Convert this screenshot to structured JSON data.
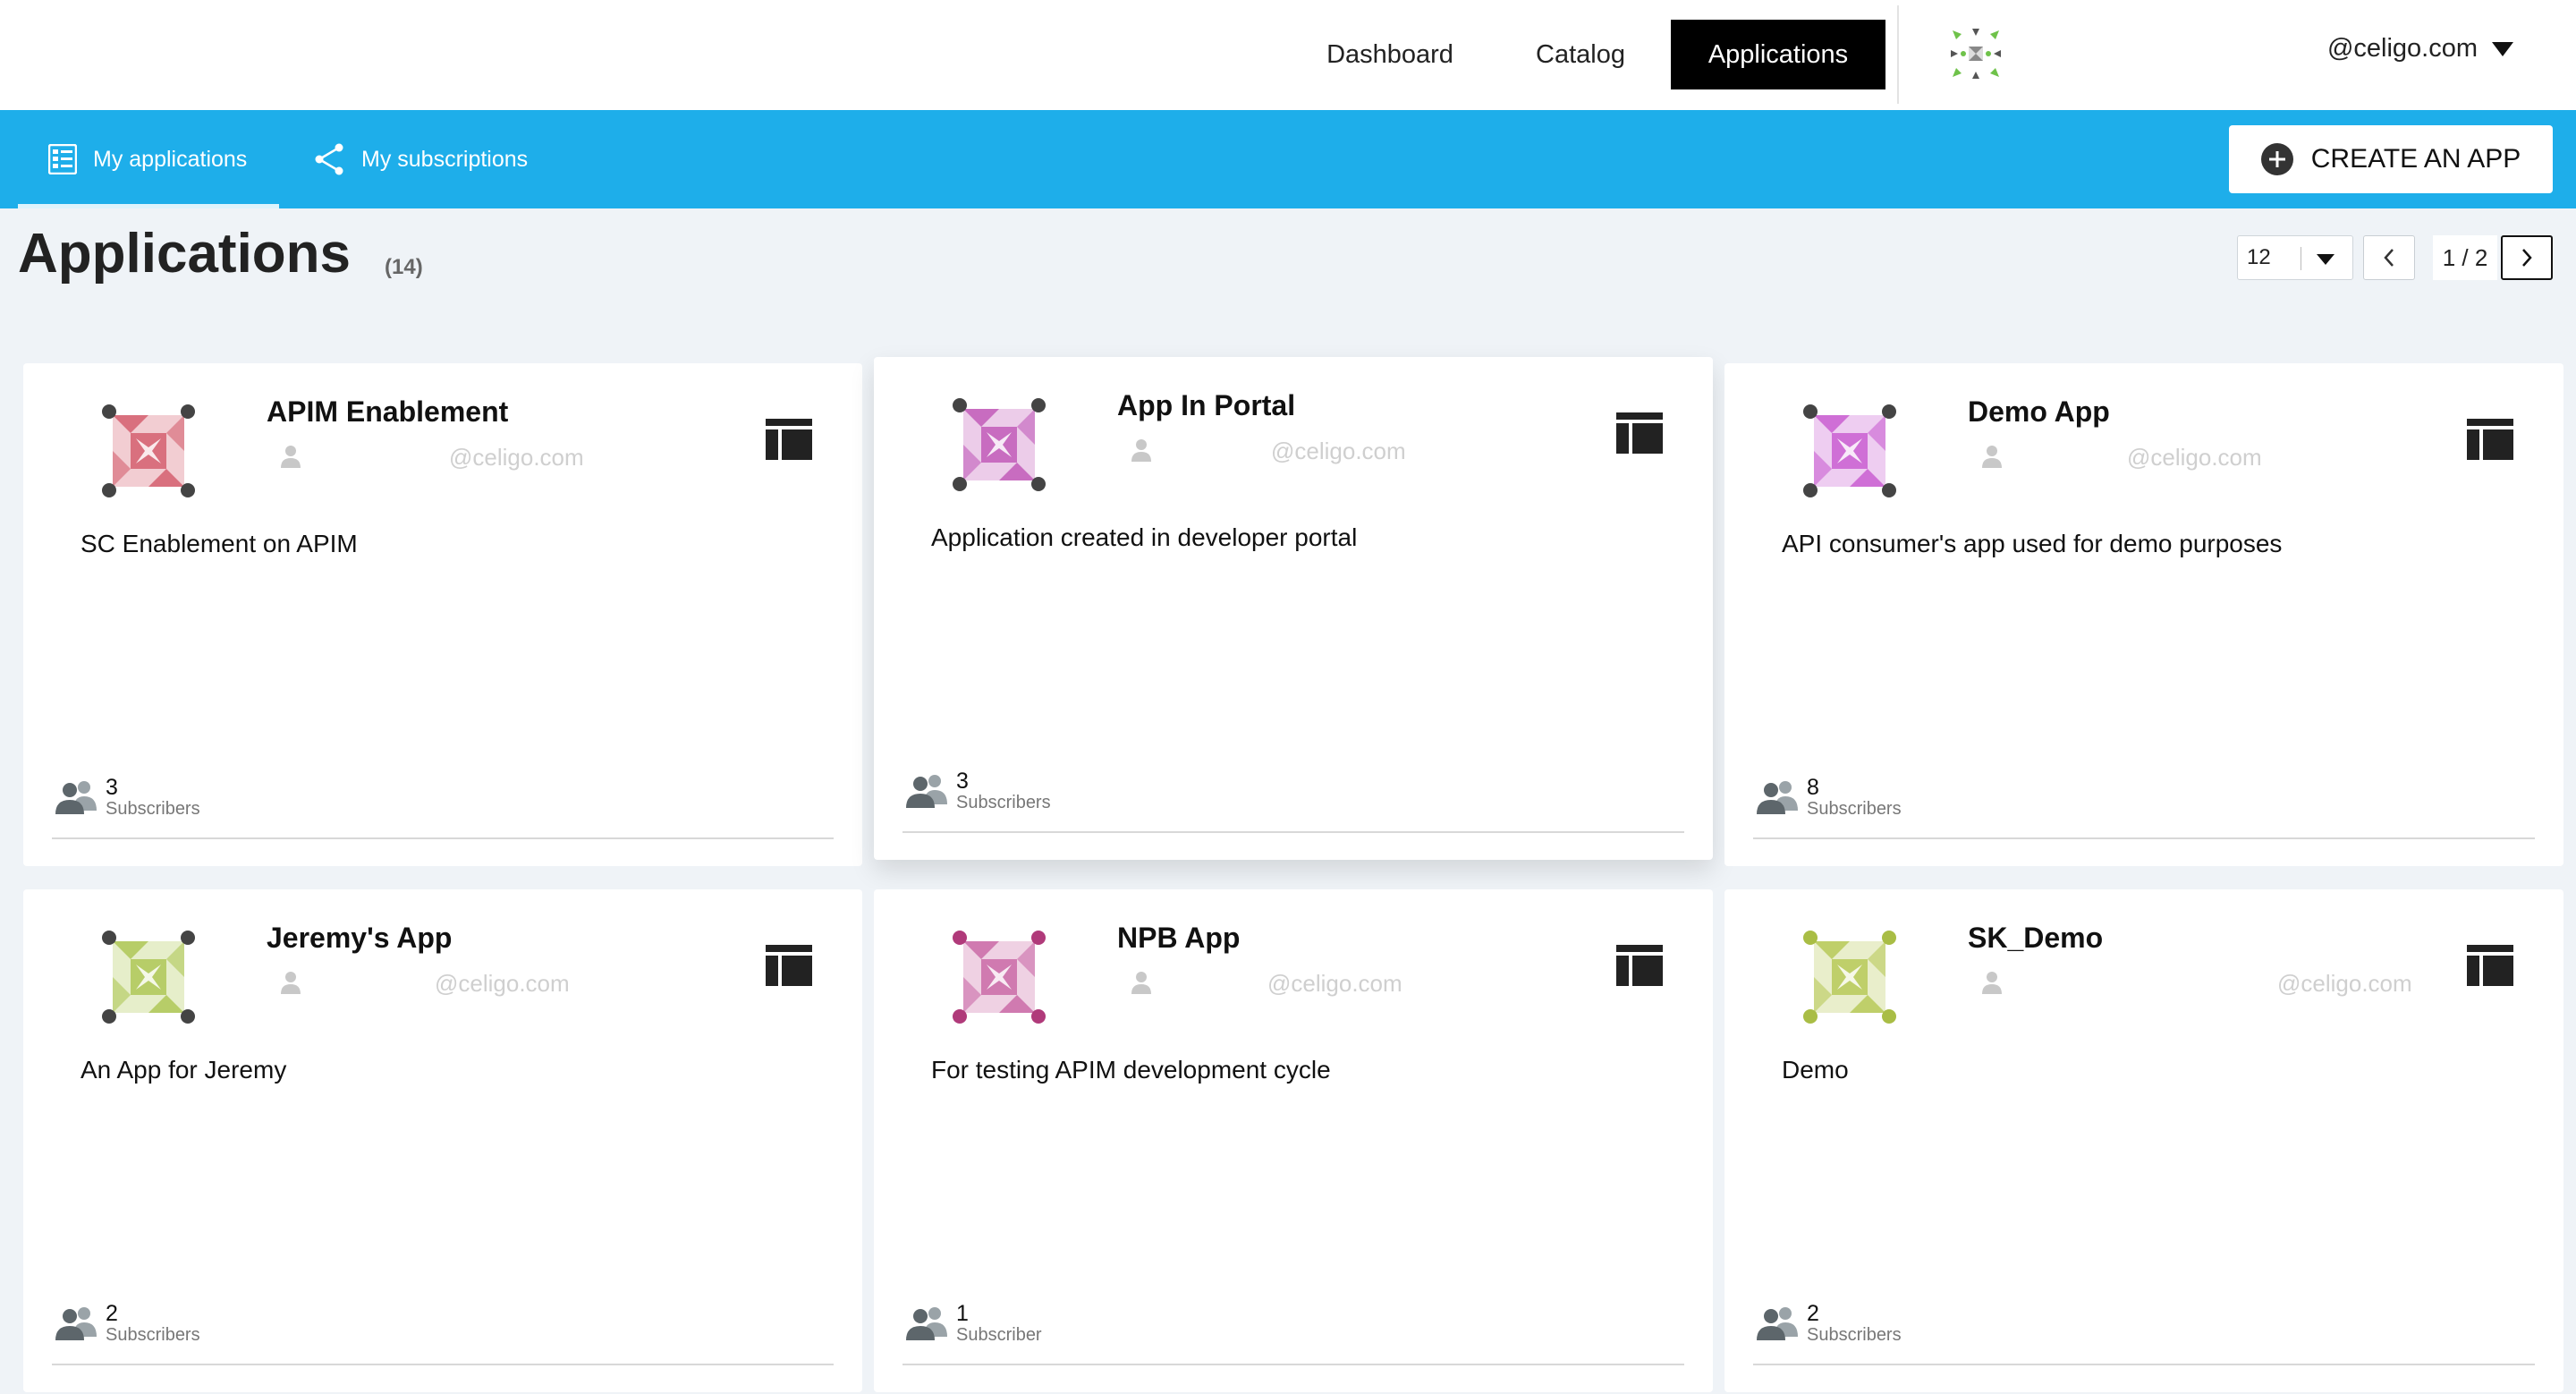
{
  "nav": {
    "items": [
      {
        "label": "Dashboard",
        "active": false
      },
      {
        "label": "Catalog",
        "active": false
      },
      {
        "label": "Applications",
        "active": true
      }
    ],
    "user": "@celigo.com"
  },
  "subnav": {
    "tabs": [
      {
        "label": "My applications",
        "icon": "applications-list-icon",
        "active": true
      },
      {
        "label": "My subscriptions",
        "icon": "share-icon",
        "active": false
      }
    ],
    "create_button": "CREATE AN APP"
  },
  "page": {
    "title": "Applications",
    "count": "(14)",
    "page_size": "12",
    "pagination": "1 / 2"
  },
  "cards": [
    {
      "name": "APIM Enablement",
      "owner": "@celigo.com",
      "description": "SC Enablement on APIM",
      "subscribers": "3",
      "subscribers_label": "Subscribers",
      "logo_color": "#d9707e",
      "logo_accent": "#444444"
    },
    {
      "name": "App In Portal",
      "owner": "@celigo.com",
      "description": "Application created in developer portal",
      "subscribers": "3",
      "subscribers_label": "Subscribers",
      "logo_color": "#c86cc0",
      "logo_accent": "#444444"
    },
    {
      "name": "Demo App",
      "owner": "@celigo.com",
      "description": "API consumer's app used for demo purposes",
      "subscribers": "8",
      "subscribers_label": "Subscribers",
      "logo_color": "#cf6fd6",
      "logo_accent": "#444444"
    },
    {
      "name": "Jeremy's App",
      "owner": "@celigo.com",
      "description": "An App for Jeremy",
      "subscribers": "2",
      "subscribers_label": "Subscribers",
      "logo_color": "#b7cd68",
      "logo_accent": "#444444"
    },
    {
      "name": "NPB App",
      "owner": "@celigo.com",
      "description": "For testing APIM development cycle",
      "subscribers": "1",
      "subscribers_label": "Subscriber",
      "logo_color": "#d07ab0",
      "logo_accent": "#b03a7a"
    },
    {
      "name": "SK_Demo",
      "owner": "@celigo.com",
      "description": "Demo",
      "subscribers": "2",
      "subscribers_label": "Subscribers",
      "logo_color": "#bfcf6a",
      "logo_accent": "#a9bd45"
    }
  ]
}
